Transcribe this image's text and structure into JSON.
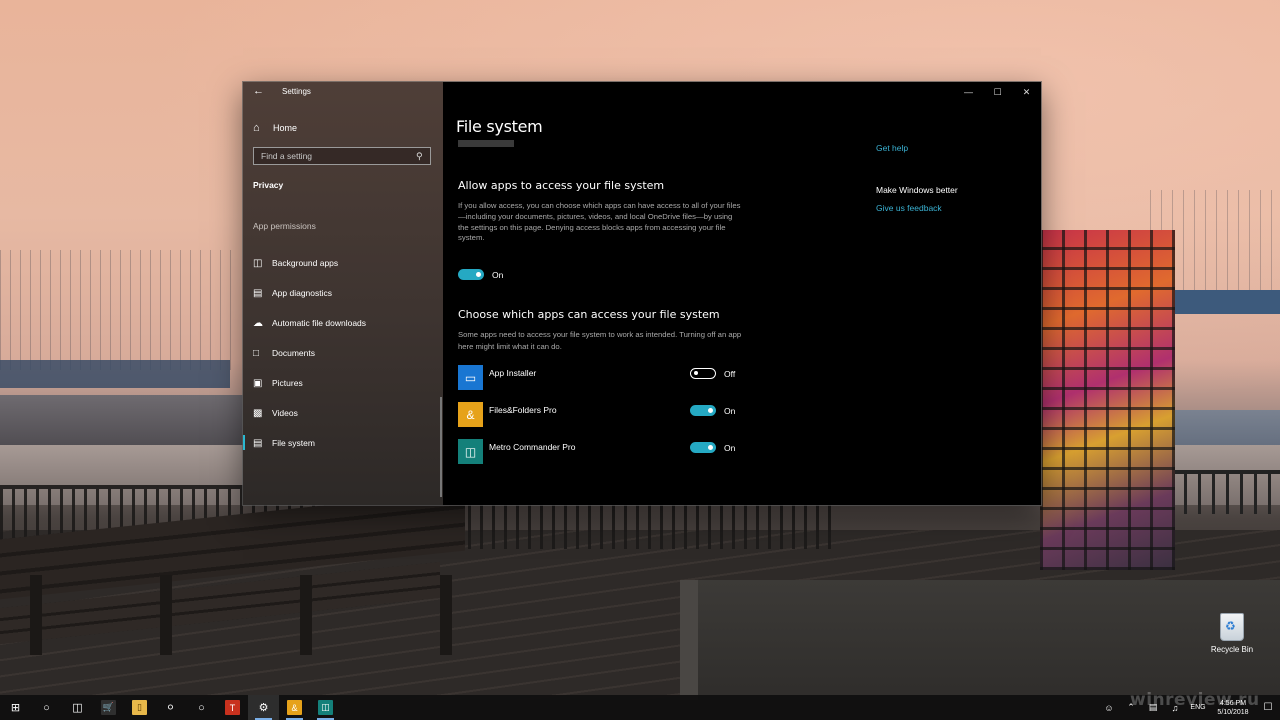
{
  "window": {
    "app_title": "Settings",
    "page_title": "File system"
  },
  "sidebar": {
    "home_label": "Home",
    "search_placeholder": "Find a setting",
    "category": "Privacy",
    "section_heading": "App permissions",
    "items": [
      {
        "label": "Background apps",
        "icon": "background-apps-icon"
      },
      {
        "label": "App diagnostics",
        "icon": "app-diagnostics-icon"
      },
      {
        "label": "Automatic file downloads",
        "icon": "cloud-icon"
      },
      {
        "label": "Documents",
        "icon": "document-icon"
      },
      {
        "label": "Pictures",
        "icon": "picture-icon"
      },
      {
        "label": "Videos",
        "icon": "video-icon"
      },
      {
        "label": "File system",
        "icon": "file-system-icon",
        "active": true
      }
    ]
  },
  "main": {
    "section1_title": "Allow apps to access your file system",
    "section1_desc": "If you allow access, you can choose which apps can have access to all of your files—including your documents, pictures, videos, and local OneDrive files—by using the settings on this page. Denying access blocks apps from accessing your file system.",
    "main_toggle_state": "On",
    "section2_title": "Choose which apps can access your file system",
    "section2_desc": "Some apps need to access your file system to work as intended. Turning off an app here might limit what it can do.",
    "apps": [
      {
        "name": "App Installer",
        "state": "Off",
        "on": false,
        "tile_color": "#1976d2"
      },
      {
        "name": "Files&Folders Pro",
        "state": "On",
        "on": true,
        "tile_color": "#e6a21a"
      },
      {
        "name": "Metro Commander Pro",
        "state": "On",
        "on": true,
        "tile_color": "#14807a"
      }
    ]
  },
  "right_panel": {
    "help_link": "Get help",
    "better_title": "Make Windows better",
    "feedback_link": "Give us feedback"
  },
  "desktop": {
    "recycle_bin_label": "Recycle Bin"
  },
  "taskbar": {
    "language": "ENG",
    "time": "4:56 PM",
    "date": "5/10/2018"
  },
  "watermark_text": "winreview.ru",
  "colors": {
    "accent": "#25a9c3",
    "link": "#3bb3d4"
  }
}
